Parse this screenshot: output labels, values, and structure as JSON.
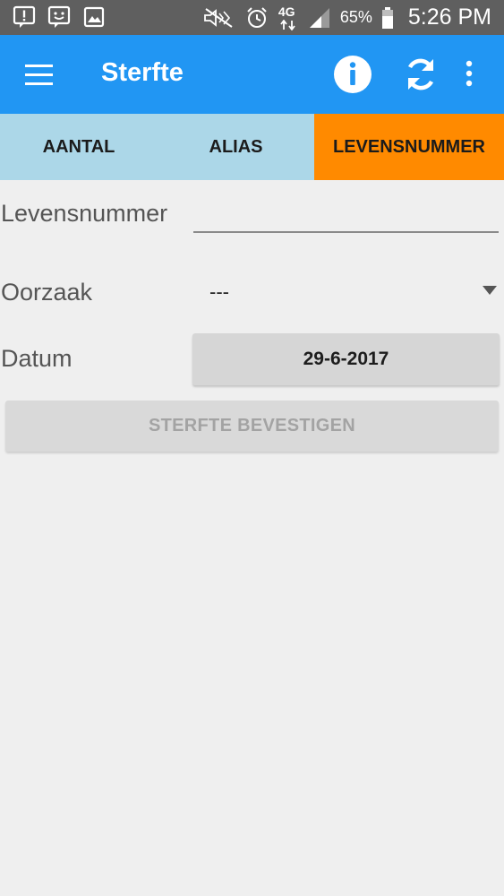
{
  "status_bar": {
    "icons_left": [
      "alert-icon",
      "message-icon",
      "image-icon"
    ],
    "icons_right": [
      "mute-icon",
      "alarm-icon",
      "network-4g-icon",
      "signal-icon",
      "battery-icon"
    ],
    "network_label": "4G",
    "battery": "65%",
    "time": "5:26 PM"
  },
  "app_bar": {
    "title": "Sterfte",
    "color": "#2196f3"
  },
  "tabs": [
    {
      "label": "AANTAL",
      "active": false
    },
    {
      "label": "ALIAS",
      "active": false
    },
    {
      "label": "LEVENSNUMMER",
      "active": true
    }
  ],
  "tab_colors": {
    "inactive": "#acd7e8",
    "active": "#ff8a00"
  },
  "form": {
    "levensnummer_label": "Levensnummer",
    "levensnummer_value": "",
    "oorzaak_label": "Oorzaak",
    "oorzaak_value": "---",
    "datum_label": "Datum",
    "datum_value": "29-6-2017"
  },
  "confirm_button": {
    "label": "STERFTE BEVESTIGEN",
    "enabled": false
  }
}
